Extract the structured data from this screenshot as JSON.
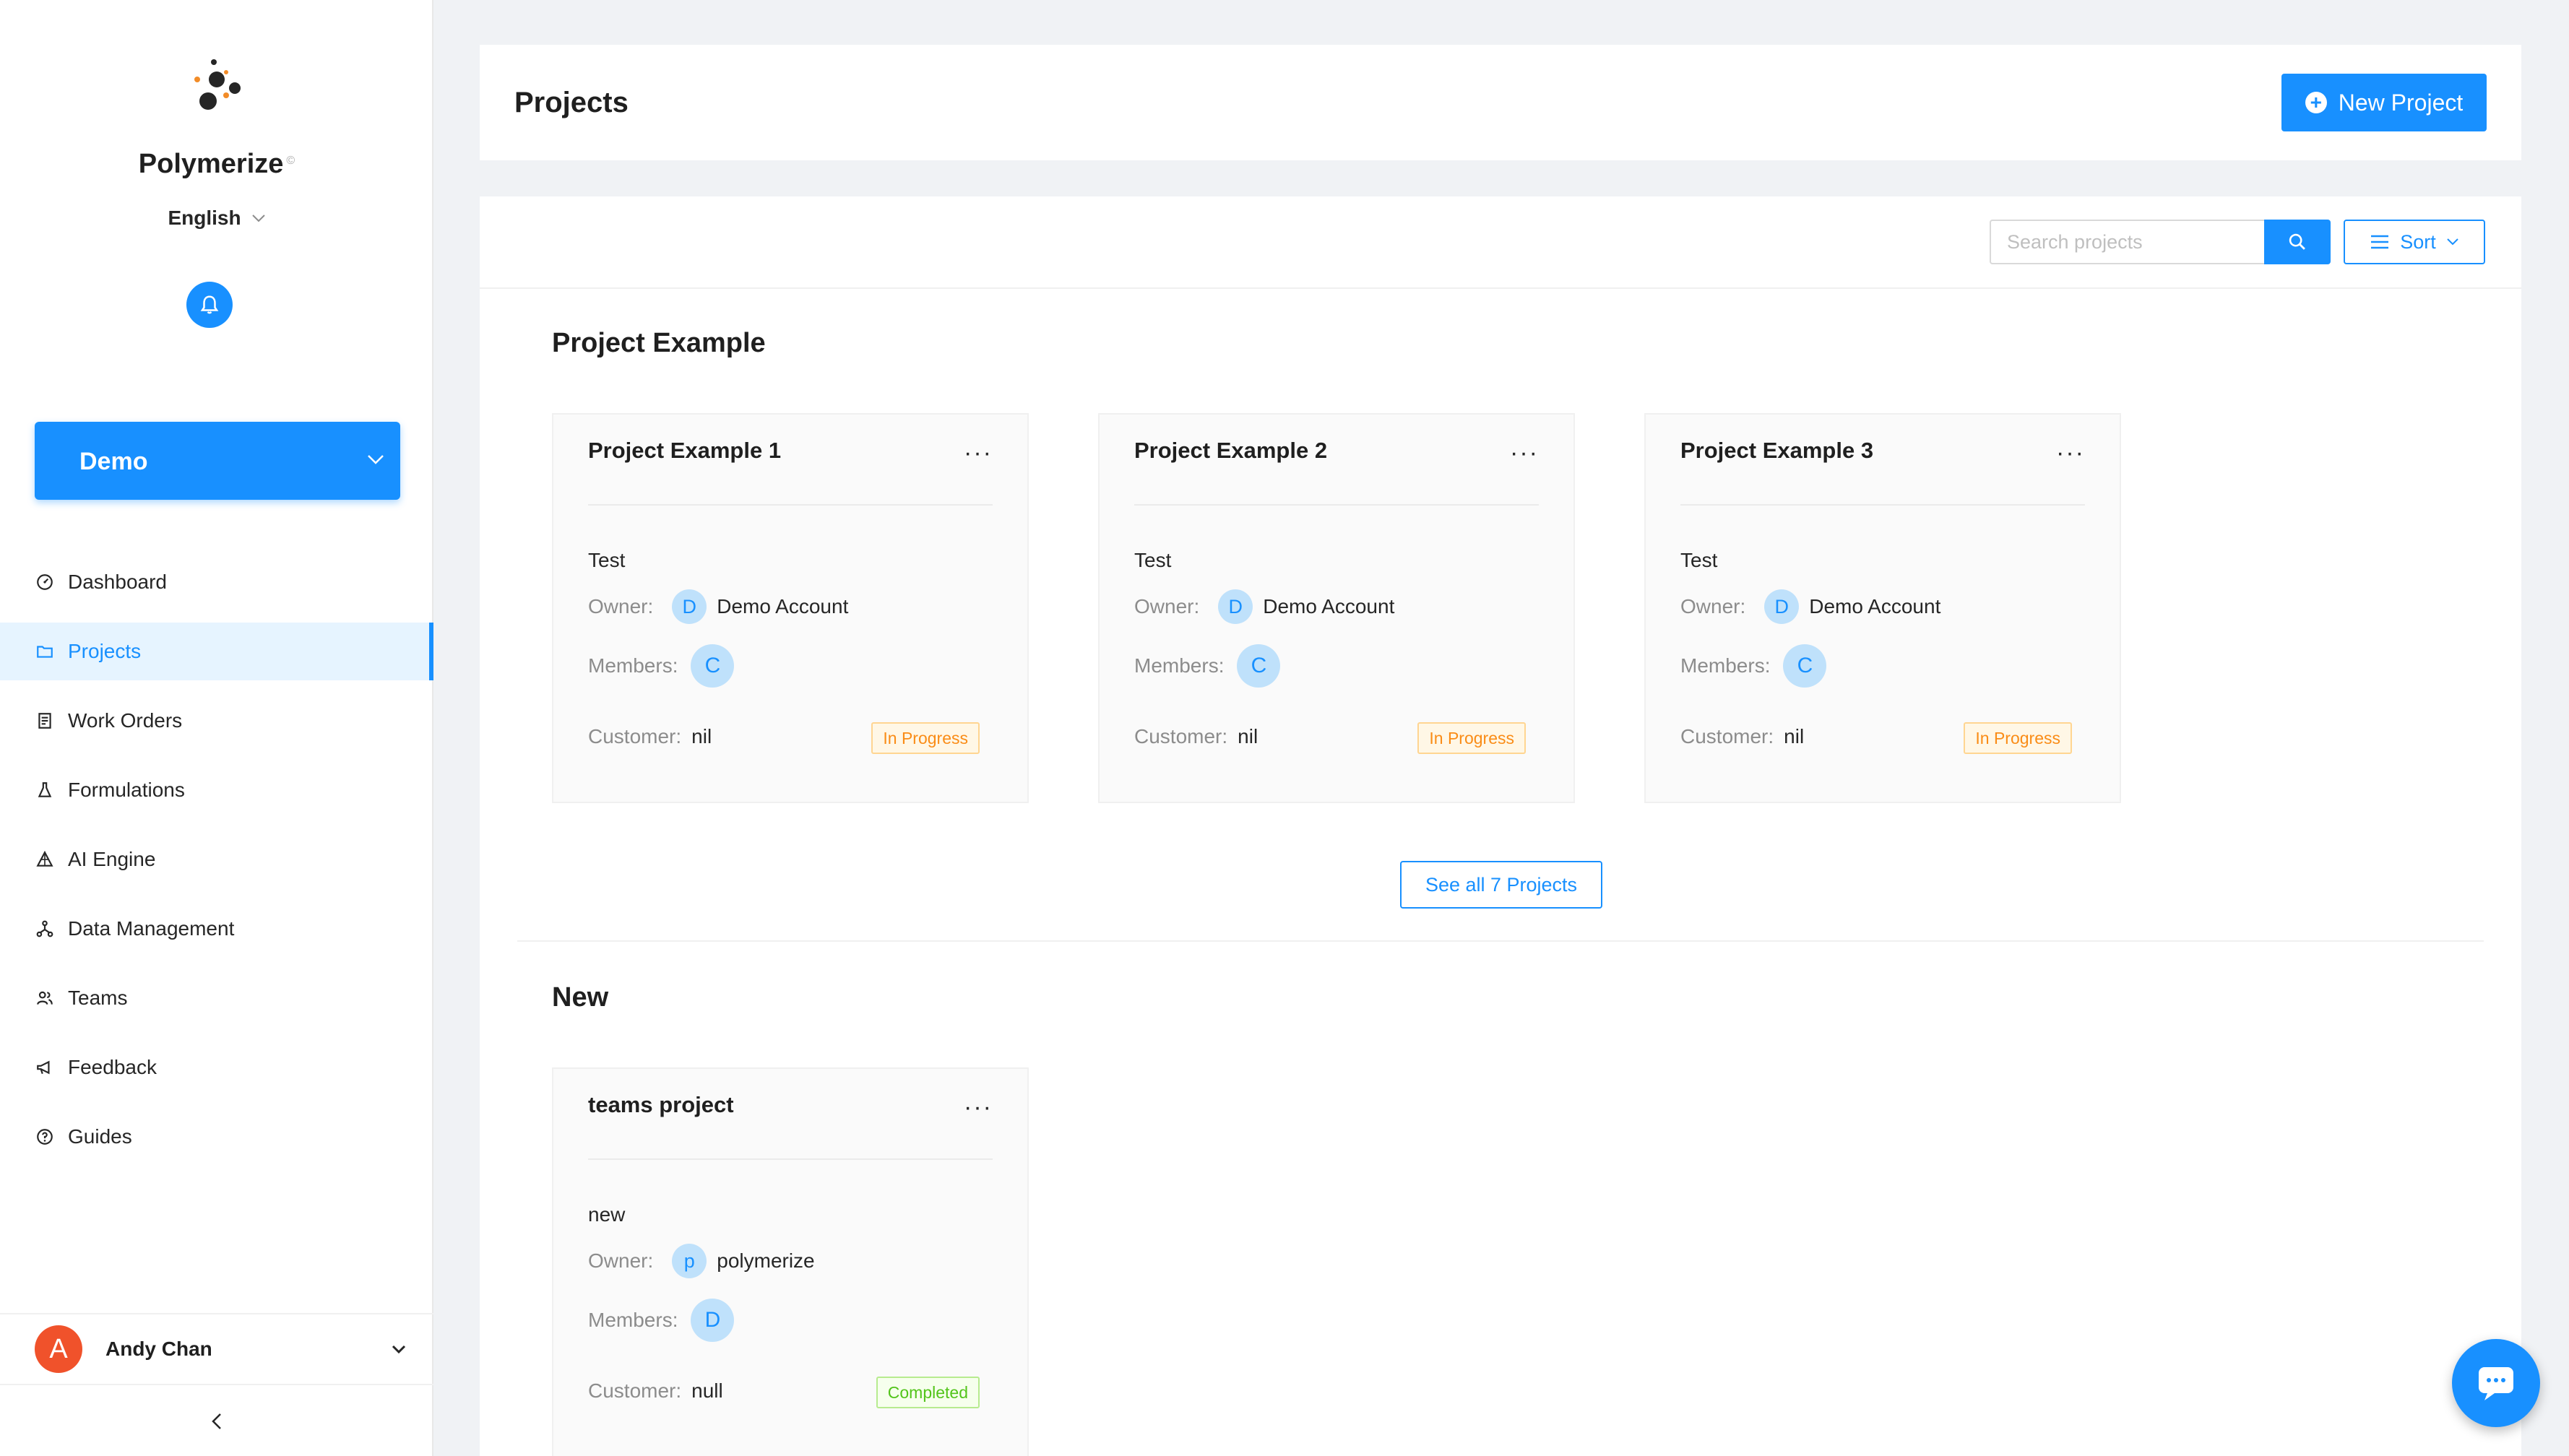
{
  "sidebar": {
    "brand": "Polymerize",
    "brand_mark": "©",
    "language": "English",
    "workspace": "Demo",
    "nav": [
      {
        "label": "Dashboard",
        "icon": "dashboard-icon"
      },
      {
        "label": "Projects",
        "icon": "folder-icon",
        "active": true
      },
      {
        "label": "Work Orders",
        "icon": "document-icon"
      },
      {
        "label": "Formulations",
        "icon": "flask-icon"
      },
      {
        "label": "AI Engine",
        "icon": "ai-engine-icon"
      },
      {
        "label": "Data Management",
        "icon": "data-network-icon"
      },
      {
        "label": "Teams",
        "icon": "teams-icon"
      },
      {
        "label": "Feedback",
        "icon": "megaphone-icon"
      },
      {
        "label": "Guides",
        "icon": "help-circle-icon"
      }
    ],
    "user": {
      "initial": "A",
      "name": "Andy Chan"
    }
  },
  "header": {
    "title": "Projects",
    "new_project_label": "New Project"
  },
  "toolbar": {
    "search_placeholder": "Search projects",
    "sort_label": "Sort"
  },
  "labels": {
    "owner": "Owner",
    "members": "Members",
    "customer": "Customer",
    "colon": ":"
  },
  "sections": [
    {
      "title": "Project Example",
      "projects": [
        {
          "title": "Project Example 1",
          "description": "Test",
          "owner_initial": "D",
          "owner": "Demo Account",
          "member_initial": "C",
          "customer": "nil",
          "status": "In Progress"
        },
        {
          "title": "Project Example 2",
          "description": "Test",
          "owner_initial": "D",
          "owner": "Demo Account",
          "member_initial": "C",
          "customer": "nil",
          "status": "In Progress"
        },
        {
          "title": "Project Example 3",
          "description": "Test",
          "owner_initial": "D",
          "owner": "Demo Account",
          "member_initial": "C",
          "customer": "nil",
          "status": "In Progress"
        }
      ],
      "see_all_label": "See all 7 Projects"
    },
    {
      "title": "New",
      "projects": [
        {
          "title": "teams project",
          "description": "new",
          "owner_initial": "p",
          "owner": "polymerize",
          "member_initial": "D",
          "customer": "null",
          "status": "Completed"
        }
      ]
    }
  ],
  "colors": {
    "primary": "#1890ff",
    "in_progress": "#fa8c16",
    "completed": "#52c41a",
    "user_avatar": "#f0522b"
  }
}
